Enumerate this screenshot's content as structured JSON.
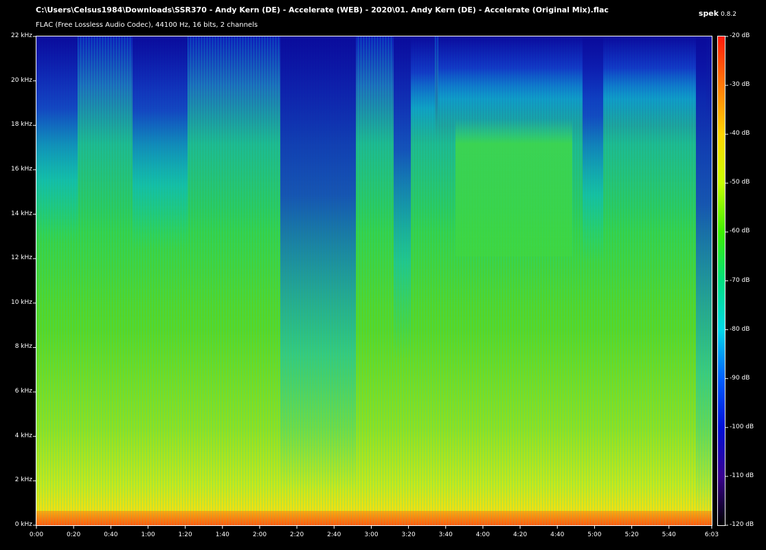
{
  "header": {
    "file_path": "C:\\Users\\Celsus1984\\Downloads\\SSR370 - Andy Kern (DE) - Accelerate (WEB) - 2020\\01. Andy Kern (DE) - Accelerate (Original Mix).flac",
    "format_info": "FLAC (Free Lossless Audio Codec), 44100 Hz, 16 bits, 2 channels",
    "app_name": "spek",
    "app_version": "0.8.2"
  },
  "y_axis": {
    "labels": [
      "22 kHz",
      "20 kHz",
      "18 kHz",
      "16 kHz",
      "14 kHz",
      "12 kHz",
      "10 kHz",
      "8 kHz",
      "6 kHz",
      "4 kHz",
      "2 kHz",
      "0 kHz"
    ],
    "values_khz": [
      22,
      20,
      18,
      16,
      14,
      12,
      10,
      8,
      6,
      4,
      2,
      0
    ]
  },
  "x_axis": {
    "labels": [
      "0:00",
      "0:20",
      "0:40",
      "1:00",
      "1:20",
      "1:40",
      "2:00",
      "2:20",
      "2:40",
      "3:00",
      "3:20",
      "3:40",
      "4:00",
      "4:20",
      "4:40",
      "5:00",
      "5:20",
      "5:40",
      "6:03"
    ],
    "values_s": [
      0,
      20,
      40,
      60,
      80,
      100,
      120,
      140,
      160,
      180,
      200,
      220,
      240,
      260,
      280,
      300,
      320,
      340,
      363
    ]
  },
  "colorbar": {
    "labels": [
      "-20 dB",
      "-30 dB",
      "-40 dB",
      "-50 dB",
      "-60 dB",
      "-70 dB",
      "-80 dB",
      "-90 dB",
      "-100 dB",
      "-110 dB",
      "-120 dB"
    ],
    "values_db": [
      -20,
      -30,
      -40,
      -50,
      -60,
      -70,
      -80,
      -90,
      -100,
      -110,
      -120
    ]
  },
  "colors": {
    "background": "#000000",
    "text": "#ffffff"
  }
}
